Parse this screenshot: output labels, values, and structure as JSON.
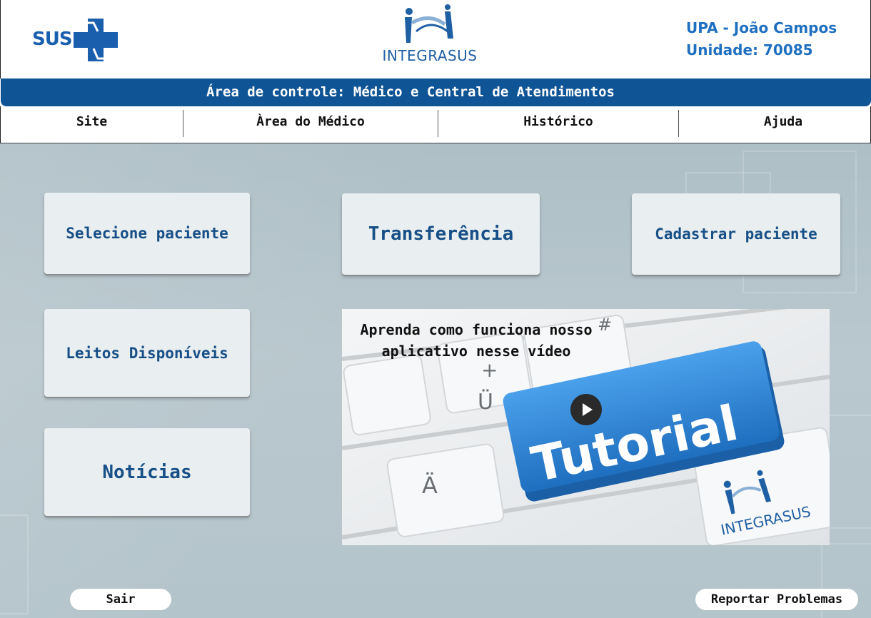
{
  "header": {
    "sus_logo_text": "SUS",
    "integrasus_logo_text": "INTEGRASUS",
    "unit_name": "UPA - João Campos",
    "unit_id": "Unidade: 70085"
  },
  "title_bar": {
    "text": "Área de controle: Médico e Central de Atendimentos"
  },
  "nav": {
    "items": [
      {
        "label": "Site"
      },
      {
        "label": "Àrea do Médico"
      },
      {
        "label": "Histórico"
      },
      {
        "label": "Ajuda"
      }
    ]
  },
  "cards": {
    "select_patient": "Selecione paciente",
    "transfer": "Transferência",
    "register_patient": "Cadastrar paciente",
    "available_beds": "Leitos Disponíveis",
    "news": "Notícias"
  },
  "video": {
    "caption": "Aprenda como funciona nosso aplicativo nesse vídeo",
    "key_text": "Tutorial",
    "key_umlaut_u": "Ü",
    "key_umlaut_a": "Ä",
    "key_plus": "+",
    "key_hash": "#",
    "brand_text": "INTEGRASUS"
  },
  "footer": {
    "logout_label": "Sair",
    "report_label": "Reportar Problemas"
  },
  "colors": {
    "brand_blue": "#0f5495",
    "card_text": "#174f86",
    "unit_text": "#1f6fc0",
    "background": "#b4c4cb",
    "tutorial_key": "#2f86d6"
  }
}
